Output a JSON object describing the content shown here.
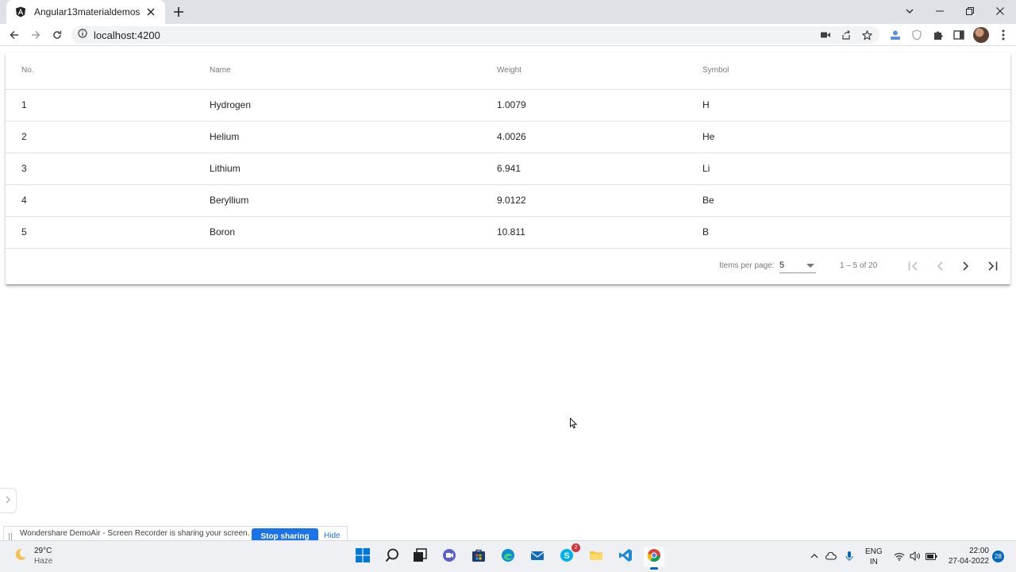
{
  "browser": {
    "tab_title": "Angular13materialdemos",
    "url": "localhost:4200"
  },
  "table": {
    "headers": [
      "No.",
      "Name",
      "Weight",
      "Symbol"
    ],
    "rows": [
      [
        "1",
        "Hydrogen",
        "1.0079",
        "H"
      ],
      [
        "2",
        "Helium",
        "4.0026",
        "He"
      ],
      [
        "3",
        "Lithium",
        "6.941",
        "Li"
      ],
      [
        "4",
        "Beryllium",
        "9.0122",
        "Be"
      ],
      [
        "5",
        "Boron",
        "10.811",
        "B"
      ]
    ]
  },
  "paginator": {
    "items_per_page_label": "Items per page:",
    "page_size": "5",
    "range_label": "1 – 5 of 20"
  },
  "share_bar": {
    "text": "Wondershare DemoAir - Screen Recorder is sharing your screen.",
    "stop_label": "Stop sharing",
    "hide_label": "Hide"
  },
  "taskbar": {
    "weather_temp": "29°C",
    "weather_condition": "Haze",
    "lang_top": "ENG",
    "lang_bottom": "IN",
    "time": "22:00",
    "date": "27-04-2022",
    "notification_count": "28",
    "skype_badge": "2",
    "accent": "#0067c0"
  }
}
